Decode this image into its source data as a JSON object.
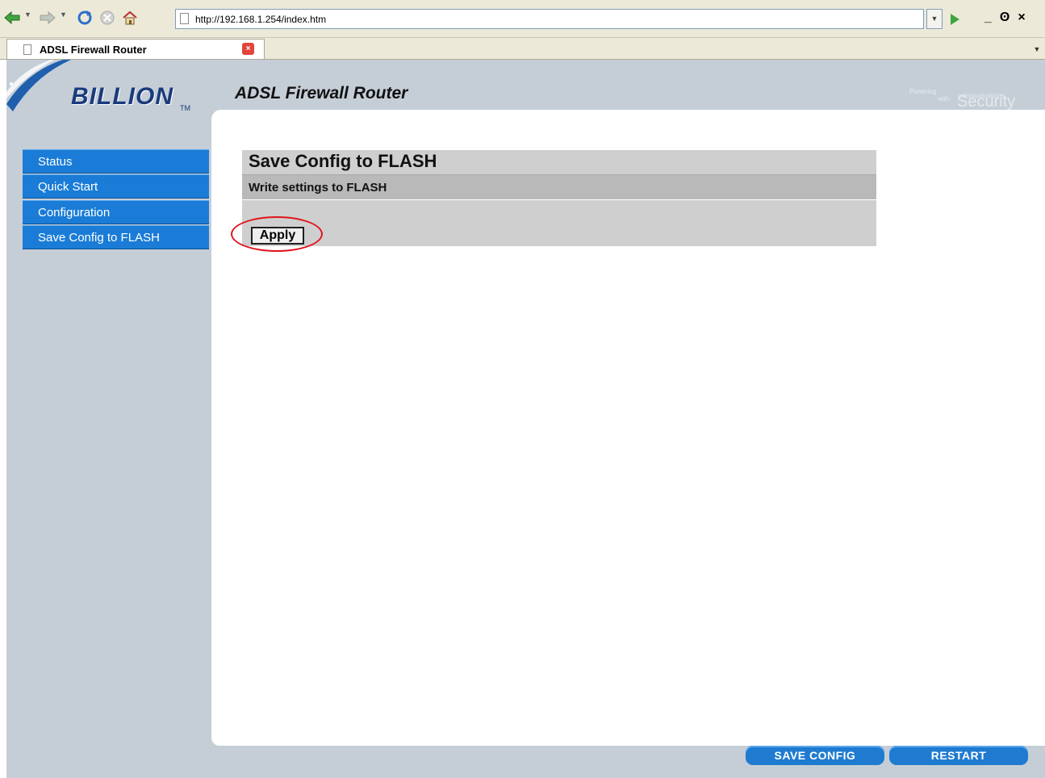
{
  "browser": {
    "url": "http://192.168.1.254/index.htm",
    "tab_title": "ADSL Firewall Router",
    "icons": [
      "back-icon",
      "forward-icon",
      "refresh-icon",
      "stop-icon",
      "home-icon",
      "go-icon",
      "minimize-icon",
      "restore-icon",
      "close-icon"
    ]
  },
  "header": {
    "brand": "BILLION",
    "tm": "TM",
    "product": "ADSL Firewall Router",
    "tagline_1": "Powering",
    "tagline_2": "communications",
    "tagline_3": "with",
    "tagline_4": "Security"
  },
  "sidebar": {
    "items": [
      {
        "label": "Status"
      },
      {
        "label": "Quick Start"
      },
      {
        "label": "Configuration"
      },
      {
        "label": "Save Config to FLASH"
      }
    ]
  },
  "main": {
    "title": "Save Config to FLASH",
    "subtitle": "Write settings to FLASH",
    "apply_label": "Apply"
  },
  "footer": {
    "save_config_label": "SAVE CONFIG",
    "restart_label": "RESTART"
  },
  "colors": {
    "nav_blue": "#1a7cd6",
    "page_background": "#c5ced7",
    "highlight_red": "#e0141c"
  }
}
